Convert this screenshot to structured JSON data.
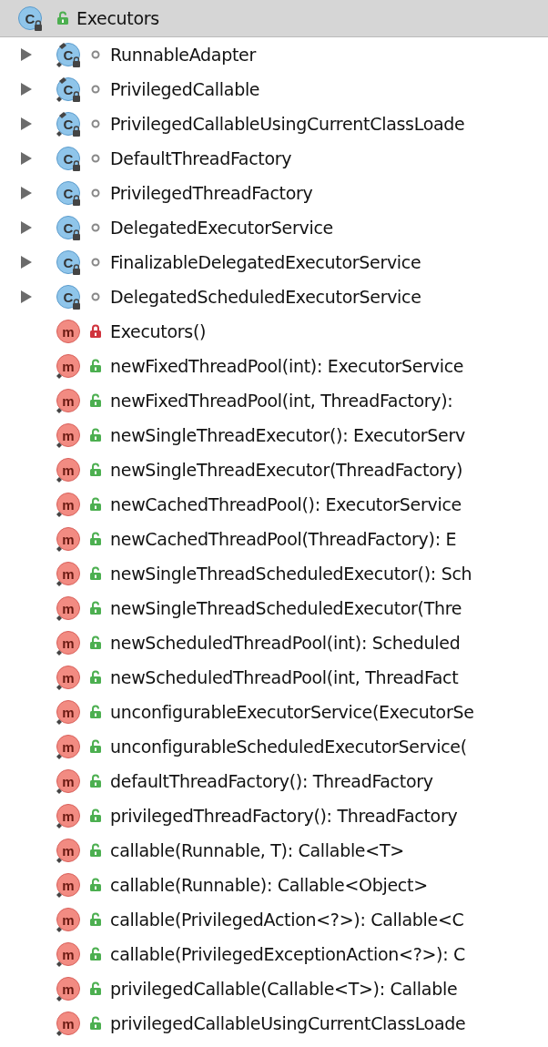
{
  "header": {
    "icon_text": "C",
    "public": true,
    "title": "Executors",
    "selected": true
  },
  "members": [
    {
      "kind": "class",
      "icon_text": "C",
      "static": true,
      "public": false,
      "expanded": false,
      "label": "RunnableAdapter"
    },
    {
      "kind": "class",
      "icon_text": "C",
      "static": true,
      "public": false,
      "expanded": false,
      "label": "PrivilegedCallable"
    },
    {
      "kind": "class",
      "icon_text": "C",
      "static": true,
      "public": false,
      "expanded": false,
      "label": "PrivilegedCallableUsingCurrentClassLoade"
    },
    {
      "kind": "class",
      "icon_text": "C",
      "static": false,
      "public": false,
      "expanded": false,
      "label": "DefaultThreadFactory"
    },
    {
      "kind": "class",
      "icon_text": "C",
      "static": false,
      "public": false,
      "expanded": false,
      "label": "PrivilegedThreadFactory"
    },
    {
      "kind": "class",
      "icon_text": "C",
      "static": false,
      "public": false,
      "expanded": false,
      "label": "DelegatedExecutorService"
    },
    {
      "kind": "class",
      "icon_text": "C",
      "static": false,
      "public": false,
      "expanded": false,
      "label": "FinalizableDelegatedExecutorService"
    },
    {
      "kind": "class",
      "icon_text": "C",
      "static": false,
      "public": false,
      "expanded": false,
      "label": "DelegatedScheduledExecutorService"
    },
    {
      "kind": "method",
      "icon_text": "m",
      "static": false,
      "private": true,
      "label": "Executors()"
    },
    {
      "kind": "method",
      "icon_text": "m",
      "static": true,
      "public": true,
      "label": "newFixedThreadPool(int): ExecutorService"
    },
    {
      "kind": "method",
      "icon_text": "m",
      "static": true,
      "public": true,
      "label": "newFixedThreadPool(int, ThreadFactory):"
    },
    {
      "kind": "method",
      "icon_text": "m",
      "static": true,
      "public": true,
      "label": "newSingleThreadExecutor(): ExecutorServ"
    },
    {
      "kind": "method",
      "icon_text": "m",
      "static": true,
      "public": true,
      "label": "newSingleThreadExecutor(ThreadFactory)"
    },
    {
      "kind": "method",
      "icon_text": "m",
      "static": true,
      "public": true,
      "label": "newCachedThreadPool(): ExecutorService"
    },
    {
      "kind": "method",
      "icon_text": "m",
      "static": true,
      "public": true,
      "label": "newCachedThreadPool(ThreadFactory): E"
    },
    {
      "kind": "method",
      "icon_text": "m",
      "static": true,
      "public": true,
      "label": "newSingleThreadScheduledExecutor(): Sch"
    },
    {
      "kind": "method",
      "icon_text": "m",
      "static": true,
      "public": true,
      "label": "newSingleThreadScheduledExecutor(Thre"
    },
    {
      "kind": "method",
      "icon_text": "m",
      "static": true,
      "public": true,
      "label": "newScheduledThreadPool(int): Scheduled"
    },
    {
      "kind": "method",
      "icon_text": "m",
      "static": true,
      "public": true,
      "label": "newScheduledThreadPool(int, ThreadFact"
    },
    {
      "kind": "method",
      "icon_text": "m",
      "static": true,
      "public": true,
      "label": "unconfigurableExecutorService(ExecutorSe"
    },
    {
      "kind": "method",
      "icon_text": "m",
      "static": true,
      "public": true,
      "label": "unconfigurableScheduledExecutorService("
    },
    {
      "kind": "method",
      "icon_text": "m",
      "static": true,
      "public": true,
      "label": "defaultThreadFactory(): ThreadFactory"
    },
    {
      "kind": "method",
      "icon_text": "m",
      "static": true,
      "public": true,
      "label": "privilegedThreadFactory(): ThreadFactory"
    },
    {
      "kind": "method",
      "icon_text": "m",
      "static": true,
      "public": true,
      "label": "callable(Runnable, T): Callable<T>"
    },
    {
      "kind": "method",
      "icon_text": "m",
      "static": true,
      "public": true,
      "label": "callable(Runnable): Callable<Object>"
    },
    {
      "kind": "method",
      "icon_text": "m",
      "static": true,
      "public": true,
      "label": "callable(PrivilegedAction<?>): Callable<C"
    },
    {
      "kind": "method",
      "icon_text": "m",
      "static": true,
      "public": true,
      "label": "callable(PrivilegedExceptionAction<?>): C"
    },
    {
      "kind": "method",
      "icon_text": "m",
      "static": true,
      "public": true,
      "label": "privilegedCallable(Callable<T>): Callable"
    },
    {
      "kind": "method",
      "icon_text": "m",
      "static": true,
      "public": true,
      "label": "privilegedCallableUsingCurrentClassLoade"
    }
  ]
}
